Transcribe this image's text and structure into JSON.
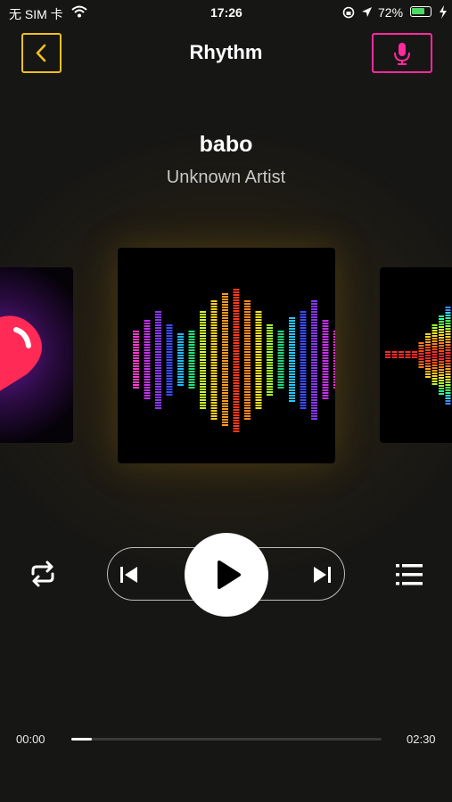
{
  "status_bar": {
    "carrier": "无 SIM 卡",
    "time": "17:26",
    "battery_percent": "72%",
    "battery_level": 0.72
  },
  "header": {
    "title": "Rhythm",
    "back_icon": "chevron-left-icon",
    "mic_icon": "microphone-icon",
    "back_color": "#f2c01d",
    "mic_color": "#ff2a9e"
  },
  "track": {
    "title": "babo",
    "artist": "Unknown Artist"
  },
  "player": {
    "repeat_icon": "repeat-icon",
    "prev_icon": "skip-previous-icon",
    "play_icon": "play-icon",
    "next_icon": "skip-next-icon",
    "playlist_icon": "playlist-icon"
  },
  "progress": {
    "current": "00:00",
    "total": "02:30",
    "fraction": 0.065
  }
}
